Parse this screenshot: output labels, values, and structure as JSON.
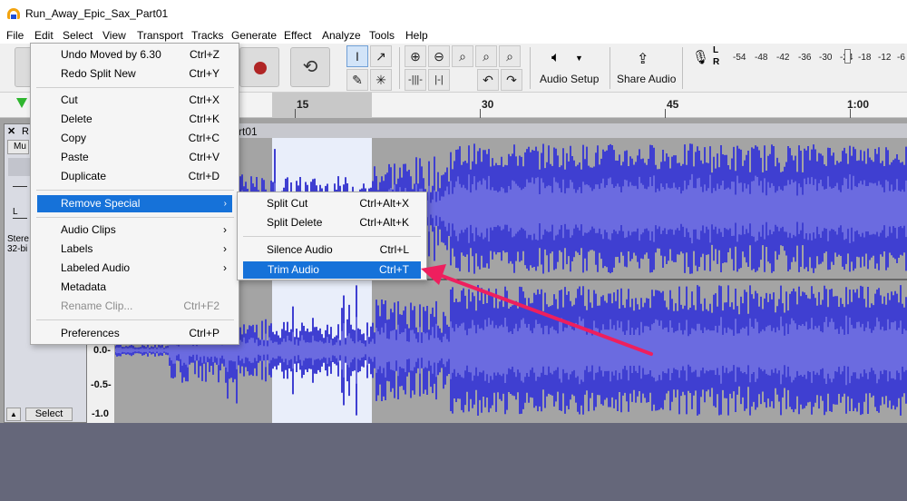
{
  "window": {
    "title": "Run_Away_Epic_Sax_Part01"
  },
  "menubar": {
    "items": [
      "File",
      "Edit",
      "Select",
      "View",
      "Transport",
      "Tracks",
      "Generate",
      "Effect",
      "Analyze",
      "Tools",
      "Help"
    ]
  },
  "toolbar": {
    "audio_setup_label": "Audio Setup",
    "share_audio_label": "Share Audio",
    "meter_channels": [
      "L",
      "R"
    ],
    "meter_ticks": [
      "-54",
      "-48",
      "-42",
      "-36",
      "-30",
      "-24",
      "-18",
      "-12",
      "-6"
    ]
  },
  "ruler": {
    "labels": [
      "15",
      "30",
      "45",
      "1:00"
    ]
  },
  "track": {
    "close_glyph": "✕",
    "name_prefix": "R",
    "clip_name": "rt01",
    "mute_label": "Mu",
    "pan_label": "L",
    "info_line1": "Stere",
    "info_line2": "32-bi",
    "scale_labels": [
      "0.0-",
      "-0.5-",
      "-1.0"
    ],
    "select_label": "Select"
  },
  "edit_menu": {
    "items": [
      {
        "label": "Undo Moved by 6.30",
        "shortcut": "Ctrl+Z"
      },
      {
        "label": "Redo Split New",
        "shortcut": "Ctrl+Y"
      },
      {
        "label": "Cut",
        "shortcut": "Ctrl+X"
      },
      {
        "label": "Delete",
        "shortcut": "Ctrl+K"
      },
      {
        "label": "Copy",
        "shortcut": "Ctrl+C"
      },
      {
        "label": "Paste",
        "shortcut": "Ctrl+V"
      },
      {
        "label": "Duplicate",
        "shortcut": "Ctrl+D"
      },
      {
        "label": "Remove Special",
        "shortcut": ""
      },
      {
        "label": "Audio Clips",
        "shortcut": ""
      },
      {
        "label": "Labels",
        "shortcut": ""
      },
      {
        "label": "Labeled Audio",
        "shortcut": ""
      },
      {
        "label": "Metadata",
        "shortcut": ""
      },
      {
        "label": "Rename Clip...",
        "shortcut": "Ctrl+F2"
      },
      {
        "label": "Preferences",
        "shortcut": "Ctrl+P"
      }
    ]
  },
  "remove_special_menu": {
    "items": [
      {
        "label": "Split Cut",
        "shortcut": "Ctrl+Alt+X"
      },
      {
        "label": "Split Delete",
        "shortcut": "Ctrl+Alt+K"
      },
      {
        "label": "Silence Audio",
        "shortcut": "Ctrl+L"
      },
      {
        "label": "Trim Audio",
        "shortcut": "Ctrl+T"
      }
    ]
  },
  "colors": {
    "waveform": "#3f3fd1",
    "waveform_rms": "#6b6be0",
    "highlight": "#1672d9",
    "arrow": "#ee1f5e",
    "selection": "#e9eefa"
  }
}
